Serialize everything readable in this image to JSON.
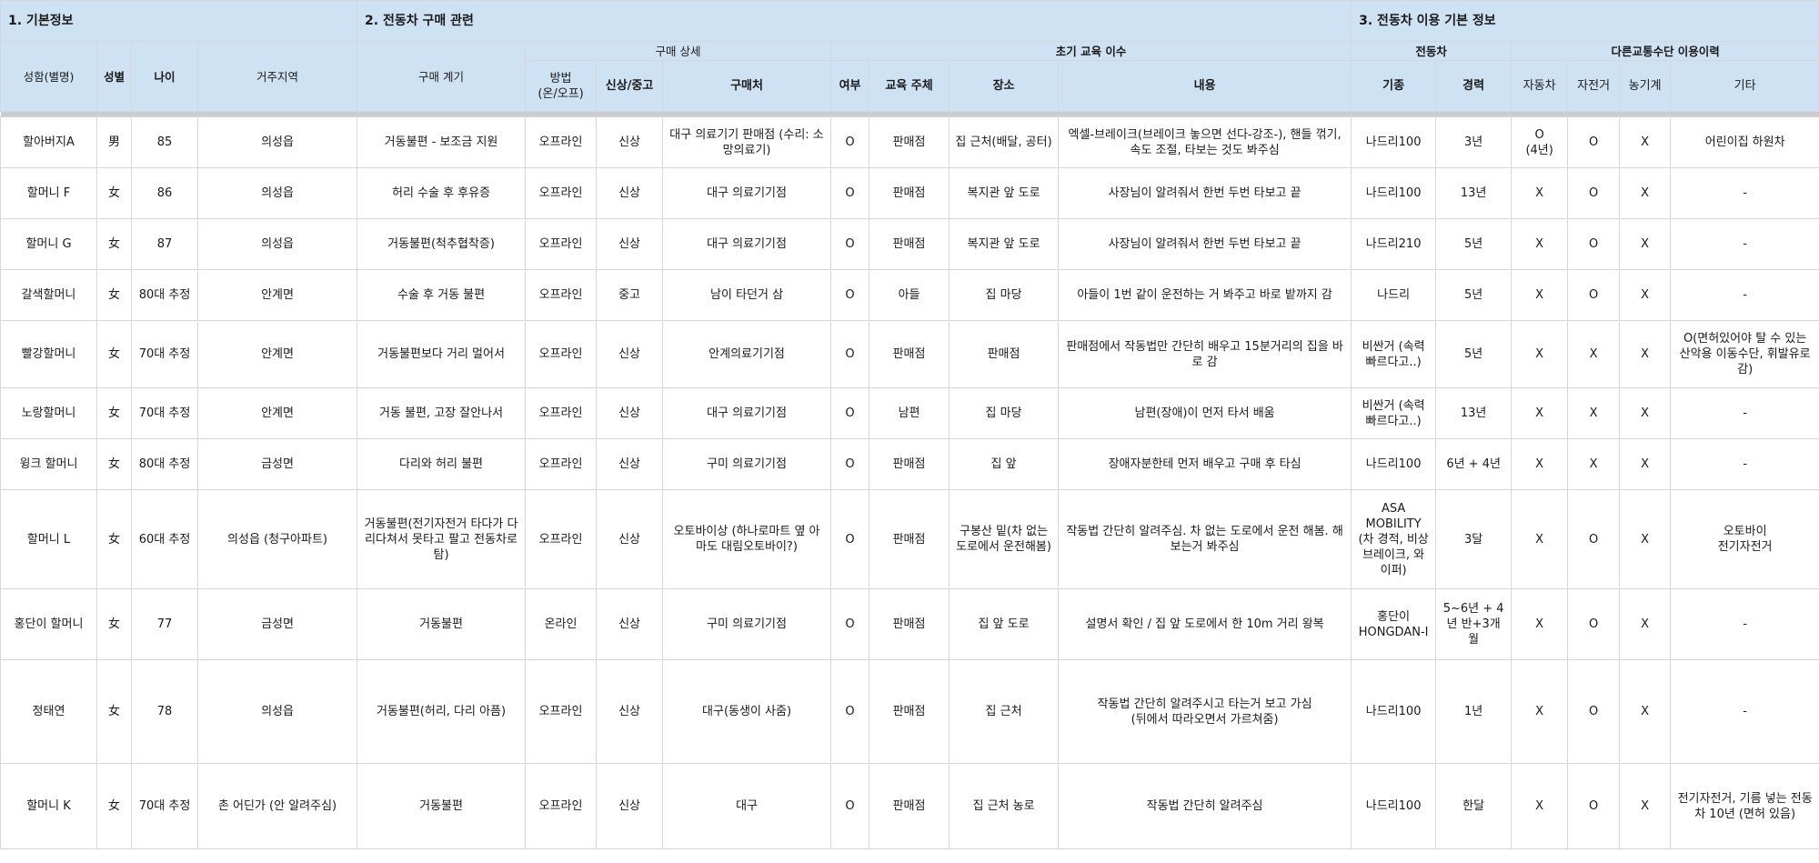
{
  "sections": {
    "basic": "1. 기본정보",
    "purchase": "2. 전동차 구매 관련",
    "usage": "3. 전동차 이용 기본 정보"
  },
  "groups": {
    "purchase_detail": "구매 상세",
    "education": "초기 교육 이수",
    "vehicle": "전동차",
    "other_transport": "다른교통수단 이용이력"
  },
  "columns": {
    "name": "성함(별명)",
    "gender": "성별",
    "age": "나이",
    "region": "거주지역",
    "reason": "구매 계기",
    "method": "방법\n(온/오프)",
    "condition": "신상/중고",
    "place": "구매처",
    "edu_done": "여부",
    "edu_by": "교육 주체",
    "edu_place": "장소",
    "edu_content": "내용",
    "model": "기종",
    "experience": "경력",
    "car": "자동차",
    "bicycle": "자전거",
    "farm": "농기계",
    "etc": "기타"
  },
  "rows": [
    {
      "name": "할아버지A",
      "gender": "男",
      "age": "85",
      "region": "의성읍",
      "reason": "거동불편 - 보조금 지원",
      "method": "오프라인",
      "condition": "신상",
      "place": "대구 의료기기 판매점 (수리: 소망의료기)",
      "edu_done": "O",
      "edu_by": "판매점",
      "edu_place": "집 근처(배달, 공터)",
      "edu_content": "엑셀-브레이크(브레이크 놓으면 선다-강조-), 핸들 꺾기, 속도 조절, 타보는 것도 봐주심",
      "model": "나드리100",
      "experience": "3년",
      "car": "O\n(4년)",
      "bicycle": "O",
      "farm": "X",
      "etc": "어린이집 하원차"
    },
    {
      "name": "할머니 F",
      "gender": "女",
      "age": "86",
      "region": "의성읍",
      "reason": "허리 수술 후 후유증",
      "method": "오프라인",
      "condition": "신상",
      "place": "대구 의료기기점",
      "edu_done": "O",
      "edu_by": "판매점",
      "edu_place": "복지관 앞 도로",
      "edu_content": "사장님이 알려줘서 한번 두번 타보고 끝",
      "model": "나드리100",
      "experience": "13년",
      "car": "X",
      "bicycle": "O",
      "farm": "X",
      "etc": "-"
    },
    {
      "name": "할머니 G",
      "gender": "女",
      "age": "87",
      "region": "의성읍",
      "reason": "거동불편(척추협착증)",
      "method": "오프라인",
      "condition": "신상",
      "place": "대구 의료기기점",
      "edu_done": "O",
      "edu_by": "판매점",
      "edu_place": "복지관 앞 도로",
      "edu_content": "사장님이 알려줘서 한번 두번 타보고 끝",
      "model": "나드리210",
      "experience": "5년",
      "car": "X",
      "bicycle": "O",
      "farm": "X",
      "etc": "-"
    },
    {
      "name": "갈색할머니",
      "gender": "女",
      "age": "80대 추정",
      "region": "안계면",
      "reason": "수술 후 거동 불편",
      "method": "오프라인",
      "condition": "중고",
      "place": "남이 타던거 삼",
      "edu_done": "O",
      "edu_by": "아들",
      "edu_place": "집 마당",
      "edu_content": "아들이 1번 같이 운전하는 거 봐주고 바로 밭까지 감",
      "model": "나드리",
      "experience": "5년",
      "car": "X",
      "bicycle": "O",
      "farm": "X",
      "etc": "-"
    },
    {
      "name": "빨강할머니",
      "gender": "女",
      "age": "70대 추정",
      "region": "안계면",
      "reason": "거동불편보다 거리 멀어서",
      "method": "오프라인",
      "condition": "신상",
      "place": "안계의료기기점",
      "edu_done": "O",
      "edu_by": "판매점",
      "edu_place": "판매점",
      "edu_content": "판매점에서 작동법만 간단히 배우고 15분거리의 집을 바로 감",
      "model": "비싼거 (속력 빠르다고..)",
      "experience": "5년",
      "car": "X",
      "bicycle": "X",
      "farm": "X",
      "etc": "O(면허있어야 탈 수 있는 산악용 이동수단, 휘발유로 감)"
    },
    {
      "name": "노랑할머니",
      "gender": "女",
      "age": "70대 추정",
      "region": "안계면",
      "reason": "거동 불편, 고장 잘안나서",
      "method": "오프라인",
      "condition": "신상",
      "place": "대구 의료기기점",
      "edu_done": "O",
      "edu_by": "남편",
      "edu_place": "집 마당",
      "edu_content": "남편(장애)이 먼저 타서 배움",
      "model": "비싼거 (속력 빠르다고..)",
      "experience": "13년",
      "car": "X",
      "bicycle": "X",
      "farm": "X",
      "etc": "-"
    },
    {
      "name": "윙크 할머니",
      "gender": "女",
      "age": "80대 추정",
      "region": "금성면",
      "reason": "다리와 허리 불편",
      "method": "오프라인",
      "condition": "신상",
      "place": "구미 의료기기점",
      "edu_done": "O",
      "edu_by": "판매점",
      "edu_place": "집 앞",
      "edu_content": "장애자분한테 먼저 배우고 구매 후 타심",
      "model": "나드리100",
      "experience": "6년 + 4년",
      "car": "X",
      "bicycle": "X",
      "farm": "X",
      "etc": "-"
    },
    {
      "name": "할머니 L",
      "gender": "女",
      "age": "60대 추정",
      "region": "의성읍 (청구아파트)",
      "reason": "거동불편(전기자전거 타다가 다리다쳐서 못타고 팔고 전동차로 탐)",
      "method": "오프라인",
      "condition": "신상",
      "place": "오토바이상 (하나로마트 옆 아마도 대림오토바이?)",
      "edu_done": "O",
      "edu_by": "판매점",
      "edu_place": "구봉산 밑(차 없는 도로에서 운전해봄)",
      "edu_content": "작동법 간단히 알려주심. 차 없는 도로에서 운전 해봄. 해보는거 봐주심",
      "model": "ASA MOBILITY (차 경적, 비상브레이크, 와이퍼)",
      "experience": "3달",
      "car": "X",
      "bicycle": "O",
      "farm": "X",
      "etc": "오토바이\n전기자전거"
    },
    {
      "name": "홍단이 할머니",
      "gender": "女",
      "age": "77",
      "region": "금성면",
      "reason": "거동불편",
      "method": "온라인",
      "condition": "신상",
      "place": "구미 의료기기점",
      "edu_done": "O",
      "edu_by": "판매점",
      "edu_place": "집 앞 도로",
      "edu_content": "설명서 확인 / 집 앞 도로에서 한 10m 거리 왕복",
      "model": "홍단이 HONGDAN-I",
      "experience": "5~6년 + 4년 반+3개월",
      "car": "X",
      "bicycle": "O",
      "farm": "X",
      "etc": "-"
    },
    {
      "name": "정태연",
      "gender": "女",
      "age": "78",
      "region": "의성읍",
      "reason": "거동불편(허리, 다리 아픔)",
      "method": "오프라인",
      "condition": "신상",
      "place": "대구(동생이 사줌)",
      "edu_done": "O",
      "edu_by": "판매점",
      "edu_place": "집 근처",
      "edu_content": "작동법 간단히 알려주시고 타는거 보고 가심\n(뒤에서 따라오면서 가르쳐줌)",
      "model": "나드리100",
      "experience": "1년",
      "car": "X",
      "bicycle": "O",
      "farm": "X",
      "etc": "-"
    },
    {
      "name": "할머니 K",
      "gender": "女",
      "age": "70대 추정",
      "region": "촌 어딘가 (안 알려주심)",
      "reason": "거동불편",
      "method": "오프라인",
      "condition": "신상",
      "place": "대구",
      "edu_done": "O",
      "edu_by": "판매점",
      "edu_place": "집 근처 농로",
      "edu_content": "작동법 간단히 알려주심",
      "model": "나드리100",
      "experience": "한달",
      "car": "X",
      "bicycle": "O",
      "farm": "X",
      "etc": "전기자전거, 기름 넣는 전동차 10년 (면허 있음)"
    }
  ]
}
